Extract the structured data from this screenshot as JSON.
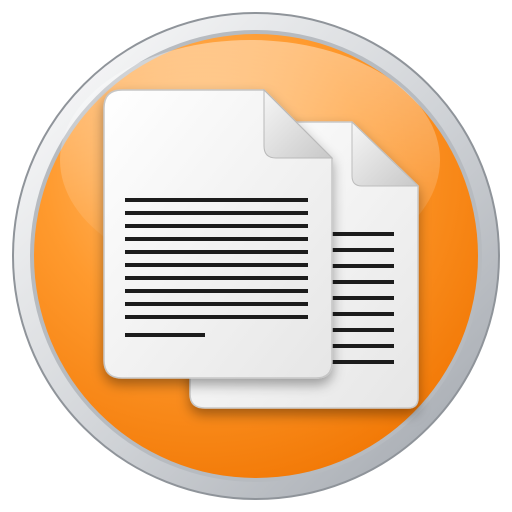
{
  "icon": {
    "name": "copy-documents-icon",
    "label": "",
    "colors": {
      "orange_light": "#ffb45a",
      "orange_mid": "#ff8c1a",
      "orange_dark": "#f07a00",
      "ring_light": "#f2f3f5",
      "ring_dark": "#a9adb3",
      "paper_light": "#ffffff",
      "paper_shade": "#dcdcdc",
      "text_lines": "#1c1c1c"
    }
  }
}
